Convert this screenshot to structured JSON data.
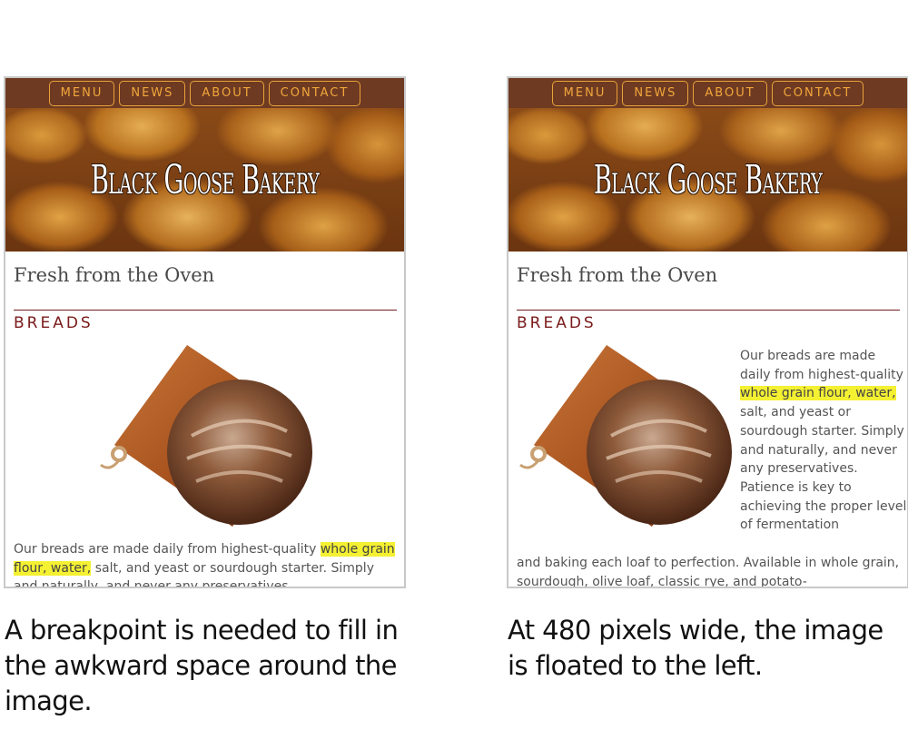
{
  "nav": {
    "items": [
      "MENU",
      "NEWS",
      "ABOUT",
      "CONTACT"
    ]
  },
  "hero": {
    "title": "Black Goose Bakery"
  },
  "section": {
    "title": "Fresh from the Oven",
    "subhead": "BREADS"
  },
  "left_example": {
    "text_before": "Our breads are made daily from highest-quality ",
    "highlight": "whole grain flour, water,",
    "text_after": " salt, and yeast or sourdough starter. Simply and naturally, and never any preservatives.",
    "caption": "A breakpoint is needed to fill in the awkward space around the image."
  },
  "right_example": {
    "float_before": "Our breads are made daily from highest-quality ",
    "highlight": "whole grain flour, water,",
    "float_after": " salt, and yeast or sourdough starter. Simply and naturally, and never any preservatives. Patience is key to achieving the proper level of fermentation",
    "wide_text": "and baking each loaf to perfection. Available in whole grain, sourdough, olive loaf, classic rye, and potato-",
    "caption": "At 480 pixels wide, the image is floated to the left."
  },
  "colors": {
    "nav_bg": "#6e3a22",
    "nav_accent": "#f2a73b",
    "subhead": "#7a1a1a",
    "highlight": "#f4f032"
  }
}
